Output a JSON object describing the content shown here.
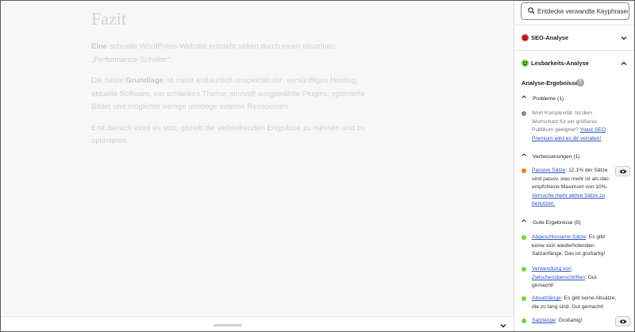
{
  "editor": {
    "heading": "Fazit",
    "para1_bold": "Eine",
    "para1": " schnelle WordPress-Website entsteht selten durch einen einzelnen „Performance-Schalter“.",
    "para2_a": "Die beste ",
    "para2_bold": "Grundlage",
    "para2_b": " ist meist erstaunlich unspektakulär: vernünftiges Hosting, aktuelle Software, ein schlankes Theme, sinnvoll ausgewählte Plugins, optimierte Bilder und möglichst wenige unnötige externe Ressourcen.",
    "para3": "Erst danach lohnt es sich, gezielt die verbleibenden Engpässe zu messen und zu optimieren."
  },
  "sidebar": {
    "search_placeholder": "Entdecke verwandte Keyphrasen",
    "seo_panel_title": "SEO-Analyse",
    "readability_panel_title": "Lesbarkeits-Analyse",
    "analysis_results_title": "Analyse-Ergebnisse",
    "help_glyph": "?",
    "problems_label": "Probleme (1)",
    "improvements_label": "Verbesserungen (1)",
    "good_label": "Gute Ergebnisse (5)",
    "problem_1_text": "Wort Komplexität: Ist dein Wortschatz für ein größeres Publikum geeignet? ",
    "problem_1_link": "Yoast SEO Premium wird es dir verraten!",
    "improvement_1_link": "Passive Sätze",
    "improvement_1_text": ": 12.1% der Sätze sind passiv, was mehr ist als das empfohlene Maximum von 10%. ",
    "improvement_1_link2": "Versuche mehr aktive Sätze zu benutzen.",
    "good_1_link": "Abgeschlossene Sätze",
    "good_1_text": ": Es gibt keine sich wiederholenden Satzanfänge. Das ist großartig!",
    "good_2_link": "Verwendung von Zwischenüberschriften",
    "good_2_text": ": Gut gemacht!",
    "good_3_link": "Absatzlänge",
    "good_3_text": ": Es gibt keine Absätze, die zu lang sind. Gut gemacht!",
    "good_4_link": "Satzlänge",
    "good_4_text": ": Großartig!"
  },
  "colors": {
    "bad": "#dc3232",
    "ok": "#ee7c1b",
    "good": "#7ad03a",
    "neutral": "#888888",
    "link": "#2a57c4"
  },
  "icons": {
    "search": "search-icon",
    "seo_face": "sad-face-icon",
    "readability_face": "smiley-face-icon",
    "collapse": "chevron-icon",
    "eye": "eye-icon"
  }
}
